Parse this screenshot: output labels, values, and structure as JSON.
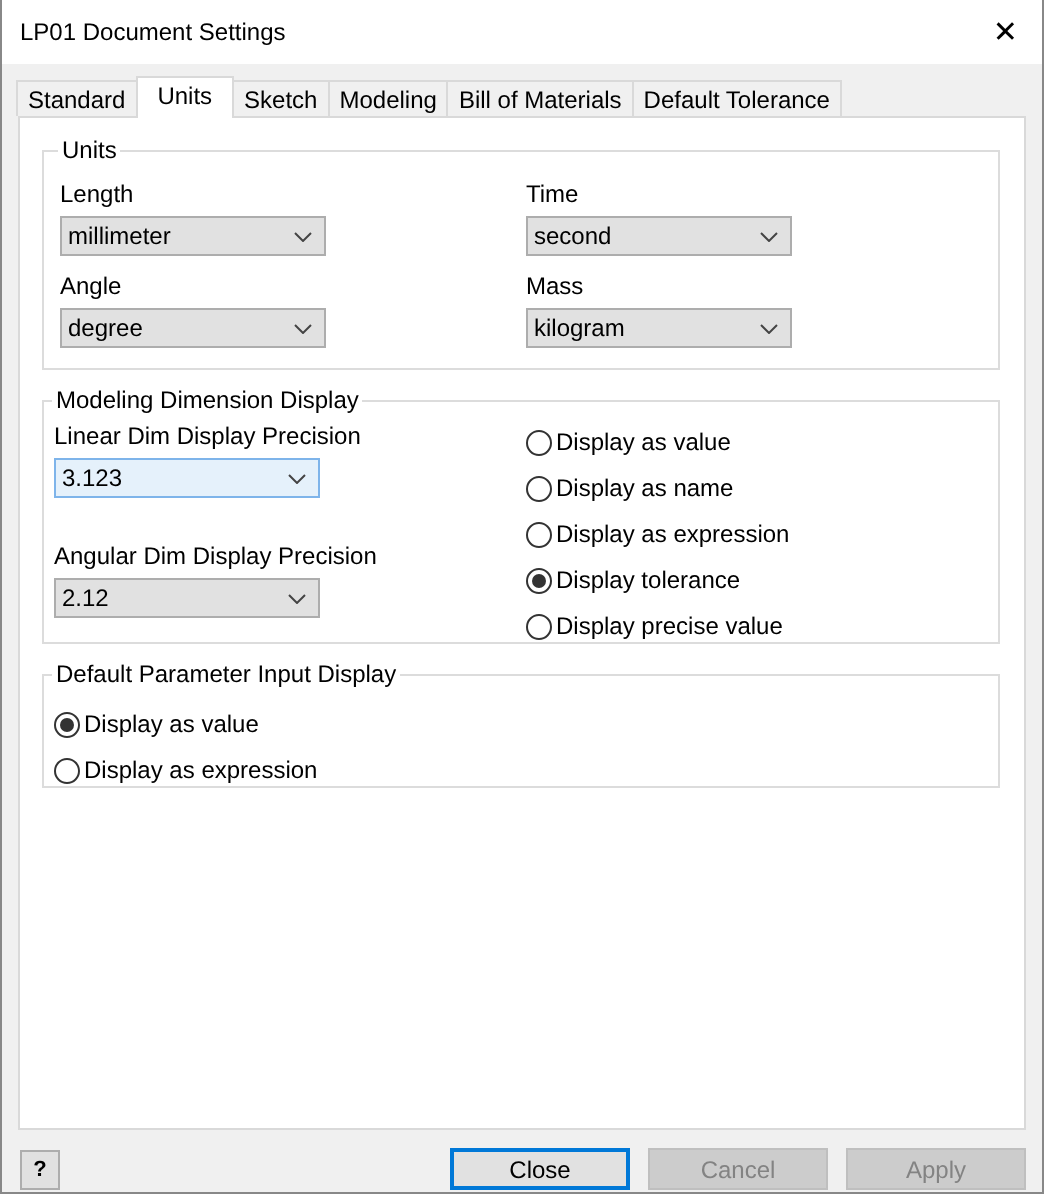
{
  "window": {
    "title": "LP01 Document Settings",
    "close": "✕"
  },
  "tabs": [
    {
      "label": "Standard",
      "selected": false
    },
    {
      "label": "Units",
      "selected": true
    },
    {
      "label": "Sketch",
      "selected": false
    },
    {
      "label": "Modeling",
      "selected": false
    },
    {
      "label": "Bill of Materials",
      "selected": false
    },
    {
      "label": "Default Tolerance",
      "selected": false
    }
  ],
  "units_group": {
    "title": "Units",
    "fields": [
      {
        "label": "Length",
        "value": "millimeter",
        "focused": false
      },
      {
        "label": "Time",
        "value": "second",
        "focused": false
      },
      {
        "label": "Angle",
        "value": "degree",
        "focused": false
      },
      {
        "label": "Mass",
        "value": "kilogram",
        "focused": false
      }
    ]
  },
  "dimension_group": {
    "title": "Modeling Dimension Display",
    "fields": [
      {
        "label": "Linear Dim Display Precision",
        "value": "3.123",
        "focused": true
      },
      {
        "label": "Angular Dim Display Precision",
        "value": "2.12",
        "focused": false
      }
    ],
    "options": [
      {
        "label": "Display as value",
        "selected": false
      },
      {
        "label": "Display as name",
        "selected": false
      },
      {
        "label": "Display as expression",
        "selected": false
      },
      {
        "label": "Display tolerance",
        "selected": true
      },
      {
        "label": "Display precise value",
        "selected": false
      }
    ]
  },
  "parameter_group": {
    "title": "Default Parameter Input Display",
    "options": [
      {
        "label": "Display as value",
        "selected": true
      },
      {
        "label": "Display as expression",
        "selected": false
      }
    ]
  },
  "help_button": {
    "label": "?"
  },
  "buttons": [
    {
      "label": "Close",
      "default": true,
      "disabled": false
    },
    {
      "label": "Cancel",
      "default": false,
      "disabled": true
    },
    {
      "label": "Apply",
      "default": false,
      "disabled": true
    }
  ]
}
